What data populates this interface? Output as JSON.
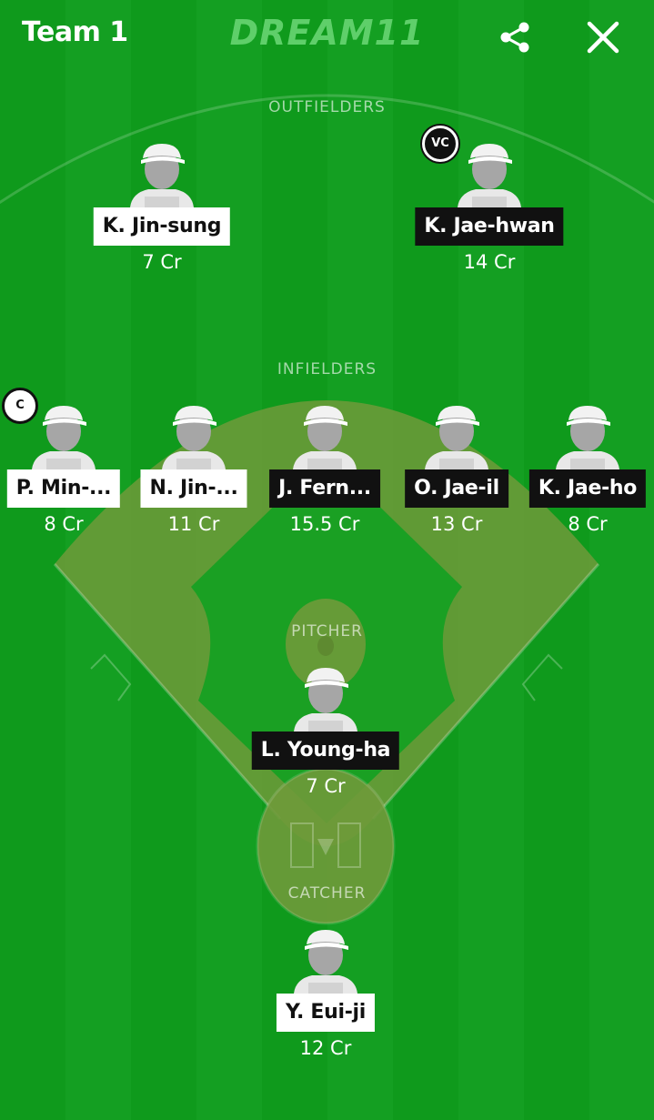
{
  "header": {
    "title": "Team 1",
    "logo": "DREAM11",
    "share_icon": "share-icon",
    "close_icon": "close-icon"
  },
  "colors": {
    "field_green": "#0f9a1c",
    "field_stripe": "#149f22",
    "infield_dirt": "#6f9a3a",
    "label_white_bg": "#ffffff",
    "label_dark_bg": "#111111"
  },
  "sections": {
    "outfielders": "OUTFIELDERS",
    "infielders": "INFIELDERS",
    "pitcher": "PITCHER",
    "catcher": "CATCHER"
  },
  "players": {
    "outfielders": [
      {
        "name": "K. Jin-sung",
        "credits": "7 Cr",
        "label_style": "light",
        "badge": ""
      },
      {
        "name": "K. Jae-hwan",
        "credits": "14 Cr",
        "label_style": "dark",
        "badge": "VC"
      }
    ],
    "infielders": [
      {
        "name": "P. Min-...",
        "credits": "8 Cr",
        "label_style": "light",
        "badge": "C"
      },
      {
        "name": "N. Jin-...",
        "credits": "11 Cr",
        "label_style": "light",
        "badge": ""
      },
      {
        "name": "J. Fern...",
        "credits": "15.5 Cr",
        "label_style": "dark",
        "badge": ""
      },
      {
        "name": "O. Jae-il",
        "credits": "13 Cr",
        "label_style": "dark",
        "badge": ""
      },
      {
        "name": "K. Jae-ho",
        "credits": "8 Cr",
        "label_style": "dark",
        "badge": ""
      }
    ],
    "pitcher": [
      {
        "name": "L. Young-ha",
        "credits": "7 Cr",
        "label_style": "dark",
        "badge": ""
      }
    ],
    "catcher": [
      {
        "name": "Y. Eui-ji",
        "credits": "12 Cr",
        "label_style": "light",
        "badge": ""
      }
    ]
  }
}
